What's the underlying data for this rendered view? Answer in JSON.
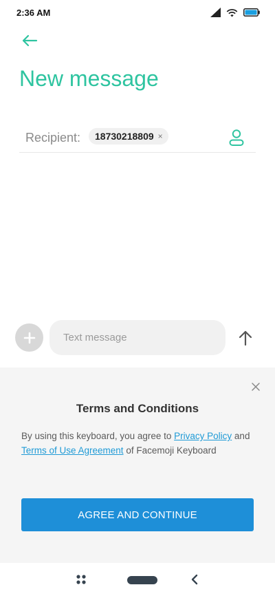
{
  "status_bar": {
    "time": "2:36 AM",
    "icons": [
      "signal-icon",
      "wifi-icon",
      "battery-icon"
    ]
  },
  "header": {
    "back_icon": "arrow-left-icon",
    "title": "New message"
  },
  "recipient": {
    "label": "Recipient:",
    "chips": [
      {
        "value": "18730218809",
        "remove_glyph": "×"
      }
    ],
    "contacts_icon": "person-icon"
  },
  "compose": {
    "add_icon": "plus-icon",
    "input_value": "",
    "placeholder": "Text message",
    "send_icon": "arrow-up-icon"
  },
  "terms": {
    "close_icon": "close-icon",
    "title": "Terms and Conditions",
    "body_prefix": "By using this keyboard, you agree to ",
    "privacy_link": "Privacy Policy",
    "body_and": " and ",
    "terms_link": "Terms of Use Agreement",
    "body_suffix": " of Facemoji Keyboard",
    "agree_button": "AGREE AND CONTINUE"
  },
  "nav_bar": {
    "icons": [
      "menu-icon",
      "home-pill-icon",
      "back-chevron-icon"
    ]
  },
  "colors": {
    "accent": "#2ec4a0",
    "link": "#1e9ad6",
    "button": "#1e8fd8",
    "panel_bg": "#f5f5f5"
  }
}
